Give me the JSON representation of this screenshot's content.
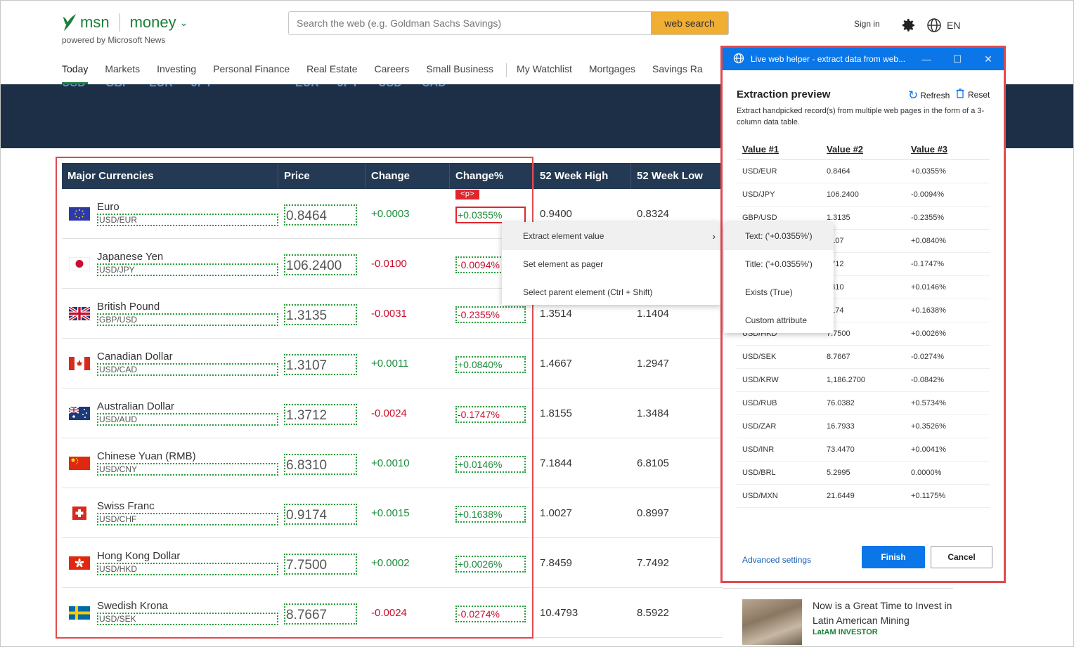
{
  "header": {
    "brand": "msn",
    "section": "money",
    "powered_by": "powered by Microsoft News",
    "search_placeholder": "Search the web (e.g. Goldman Sachs Savings)",
    "search_button": "web search",
    "sign_in": "Sign in",
    "language": "EN"
  },
  "nav": [
    "Today",
    "Markets",
    "Investing",
    "Personal Finance",
    "Real Estate",
    "Careers",
    "Small Business",
    "My Watchlist",
    "Mortgages",
    "Savings Ra"
  ],
  "banner_ticks": [
    "USD",
    "GBP",
    "EUR",
    "JPY",
    "EUR",
    "JPY",
    "USD",
    "CAD"
  ],
  "currency_table": {
    "headers": [
      "Major Currencies",
      "Price",
      "Change",
      "Change%",
      "52 Week High",
      "52 Week Low"
    ],
    "selected_tag": "<p>",
    "rows": [
      {
        "name": "Euro",
        "code": "USD/EUR",
        "price": "0.8464",
        "change": "+0.0003",
        "pct": "+0.0355%",
        "high": "0.9400",
        "low": "0.8324",
        "flag": "eu"
      },
      {
        "name": "Japanese Yen",
        "code": "USD/JPY",
        "price": "106.2400",
        "change": "-0.0100",
        "pct": "-0.0094%",
        "high": "",
        "low": "",
        "flag": "jp"
      },
      {
        "name": "British Pound",
        "code": "GBP/USD",
        "price": "1.3135",
        "change": "-0.0031",
        "pct": "-0.2355%",
        "high": "1.3514",
        "low": "1.1404",
        "flag": "gb"
      },
      {
        "name": "Canadian Dollar",
        "code": "USD/CAD",
        "price": "1.3107",
        "change": "+0.0011",
        "pct": "+0.0840%",
        "high": "1.4667",
        "low": "1.2947",
        "flag": "ca"
      },
      {
        "name": "Australian Dollar",
        "code": "USD/AUD",
        "price": "1.3712",
        "change": "-0.0024",
        "pct": "-0.1747%",
        "high": "1.8155",
        "low": "1.3484",
        "flag": "au"
      },
      {
        "name": "Chinese Yuan (RMB)",
        "code": "USD/CNY",
        "price": "6.8310",
        "change": "+0.0010",
        "pct": "+0.0146%",
        "high": "7.1844",
        "low": "6.8105",
        "flag": "cn"
      },
      {
        "name": "Swiss Franc",
        "code": "USD/CHF",
        "price": "0.9174",
        "change": "+0.0015",
        "pct": "+0.1638%",
        "high": "1.0027",
        "low": "0.8997",
        "flag": "ch"
      },
      {
        "name": "Hong Kong Dollar",
        "code": "USD/HKD",
        "price": "7.7500",
        "change": "+0.0002",
        "pct": "+0.0026%",
        "high": "7.8459",
        "low": "7.7492",
        "flag": "hk"
      },
      {
        "name": "Swedish Krona",
        "code": "USD/SEK",
        "price": "8.7667",
        "change": "-0.0024",
        "pct": "-0.0274%",
        "high": "10.4793",
        "low": "8.5922",
        "flag": "se"
      }
    ]
  },
  "context_menu": {
    "items": [
      "Extract element value",
      "Set element as pager",
      "Select parent element  (Ctrl + Shift)"
    ],
    "submenu": [
      "Text:  ('+0.0355%')",
      "Title:  ('+0.0355%')",
      "Exists (True)",
      "Custom attribute"
    ]
  },
  "helper": {
    "title": "Live web helper - extract data from web...",
    "heading": "Extraction preview",
    "refresh": "Refresh",
    "reset": "Reset",
    "description": "Extract handpicked record(s) from multiple web pages in the form of a 3-column data table.",
    "columns": [
      "Value #1",
      "Value #2",
      "Value #3"
    ],
    "rows": [
      [
        "USD/EUR",
        "0.8464",
        "+0.0355%"
      ],
      [
        "USD/JPY",
        "106.2400",
        "-0.0094%"
      ],
      [
        "GBP/USD",
        "1.3135",
        "-0.2355%"
      ],
      [
        "",
        "3107",
        "+0.0840%"
      ],
      [
        "",
        "3712",
        "-0.1747%"
      ],
      [
        "",
        "3310",
        "+0.0146%"
      ],
      [
        "",
        "9174",
        "+0.1638%"
      ],
      [
        "USD/HKD",
        "7.7500",
        "+0.0026%"
      ],
      [
        "USD/SEK",
        "8.7667",
        "-0.0274%"
      ],
      [
        "USD/KRW",
        "1,186.2700",
        "-0.0842%"
      ],
      [
        "USD/RUB",
        "76.0382",
        "+0.5734%"
      ],
      [
        "USD/ZAR",
        "16.7933",
        "+0.3526%"
      ],
      [
        "USD/INR",
        "73.4470",
        "+0.0041%"
      ],
      [
        "USD/BRL",
        "5.2995",
        "0.0000%"
      ],
      [
        "USD/MXN",
        "21.6449",
        "+0.1175%"
      ]
    ],
    "advanced": "Advanced settings",
    "finish": "Finish",
    "cancel": "Cancel"
  },
  "news": {
    "title": "Now is a Great Time to Invest in Latin American Mining",
    "source": "LatAM INVESTOR"
  },
  "colors": {
    "brand_green": "#1a7f37",
    "accent_blue": "#0a76e8",
    "frame_red": "#e04a4f",
    "header_dark": "#243a54"
  }
}
